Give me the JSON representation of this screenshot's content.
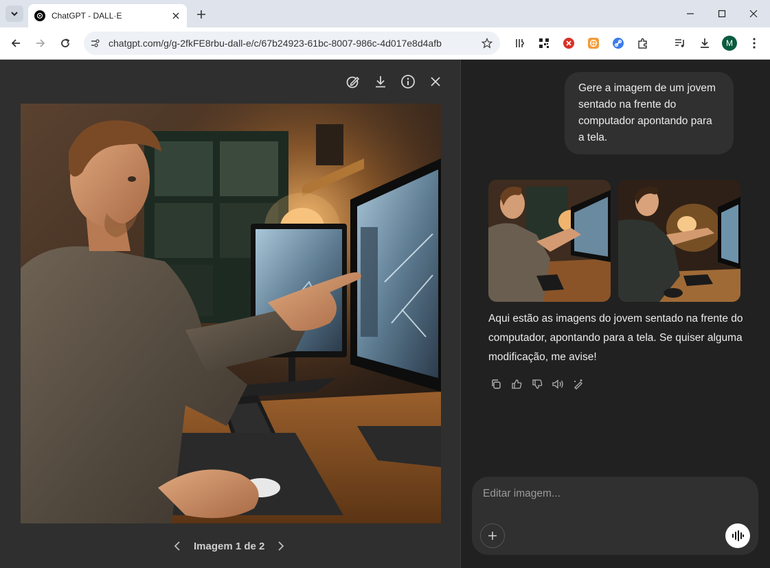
{
  "browser": {
    "tab_title": "ChatGPT - DALL·E",
    "url": "chatgpt.com/g/g-2fkFE8rbu-dall-e/c/67b24923-61bc-8007-986c-4d017e8d4afb",
    "profile_initial": "M"
  },
  "viewer": {
    "pager_label": "Imagem 1 de 2",
    "image_alt": "Jovem sentado na frente do computador apontando para a tela"
  },
  "chat": {
    "user_message": "Gere a imagem de um jovem sentado na frente do computador apontando para a tela.",
    "assistant_message": "Aqui estão as imagens do jovem sentado na frente do computador, apontando para a tela. Se quiser alguma modificação, me avise!",
    "composer_placeholder": "Editar imagem..."
  },
  "colors": {
    "accent_red": "#d93025",
    "accent_orange": "#f29b38",
    "accent_blue": "#3b7bea",
    "avatar_green": "#0b5c3e"
  }
}
